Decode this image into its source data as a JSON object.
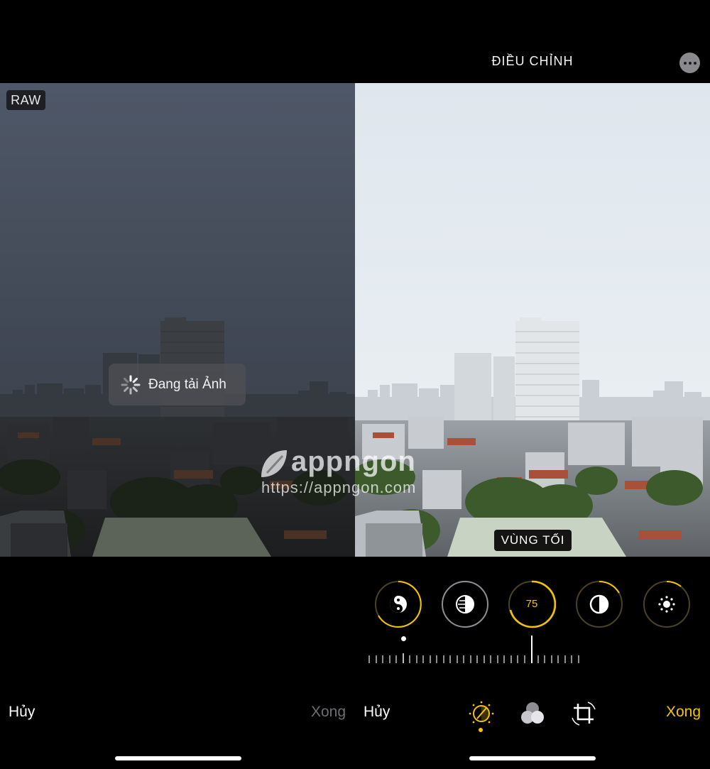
{
  "left": {
    "raw_badge": "RAW",
    "loading_text": "Đang tải Ảnh",
    "cancel_label": "Hủy",
    "done_label": "Xong"
  },
  "right": {
    "title": "ĐIỀU CHỈNH",
    "more_icon": "ellipsis-circle-icon",
    "active_tool_label": "VÙNG TỐI",
    "dials": [
      {
        "icon": "auto-yin-yang-icon"
      },
      {
        "icon": "exposure-icon"
      },
      {
        "value": "75",
        "icon": "shadows-icon"
      },
      {
        "icon": "contrast-icon"
      },
      {
        "icon": "brightness-icon"
      }
    ],
    "tools": [
      "adjust-icon",
      "filters-icon",
      "crop-icon"
    ],
    "cancel_label": "Hủy",
    "done_label": "Xong"
  },
  "watermark": {
    "brand": "appngon",
    "url": "https://appngon.com"
  },
  "colors": {
    "accent": "#f5c400",
    "background": "#000000",
    "dim_text": "#6e6e72"
  }
}
